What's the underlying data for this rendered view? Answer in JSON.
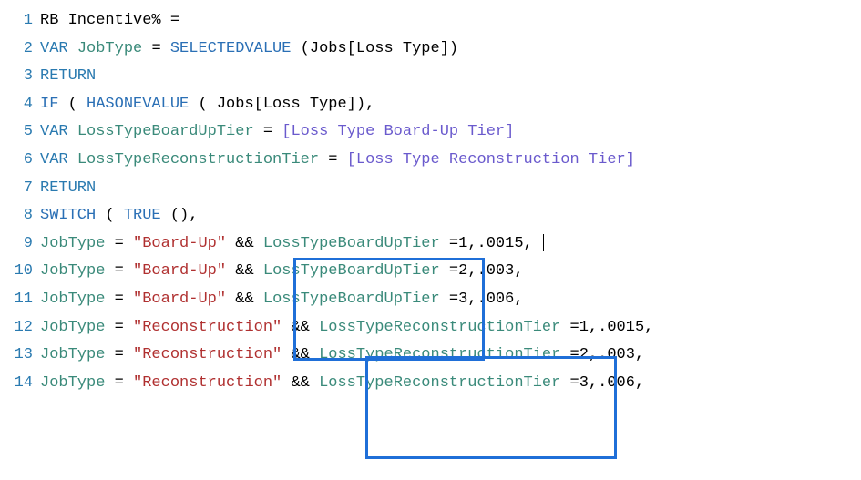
{
  "lines": {
    "l1": {
      "no": "1",
      "t1": "RB Incentive% ="
    },
    "l2": {
      "no": "2",
      "kw": "VAR",
      "ident": "JobType",
      "eq": "= ",
      "func": "SELECTEDVALUE",
      "args": "(Jobs[Loss Type])"
    },
    "l3": {
      "no": "3",
      "kw": "RETURN"
    },
    "l4": {
      "no": "4",
      "func1": "IF",
      "p1": "( ",
      "func2": "HASONEVALUE",
      "p2": "( Jobs[Loss Type]),"
    },
    "l5": {
      "no": "5",
      "kw": "VAR",
      "ident": "LossTypeBoardUpTier",
      "eq": " = ",
      "measure": "[Loss Type Board-Up Tier]"
    },
    "l6": {
      "no": "6",
      "kw": "VAR",
      "ident": "LossTypeReconstructionTier",
      "eq": " = ",
      "measure": "[Loss Type Reconstruction Tier]"
    },
    "l7": {
      "no": "7",
      "kw": "RETURN"
    },
    "l8": {
      "no": "8",
      "func": "SWITCH",
      "p1": "( ",
      "func2": "TRUE",
      "p2": "(),"
    },
    "l9": {
      "no": "9",
      "ident1": "JobType",
      "eq": "= ",
      "str": "\"Board-Up\"",
      "amp": " &&",
      "ident2": "LossTypeBoardUpTier",
      "rest": "=1,.0015,"
    },
    "l10": {
      "no": "10",
      "ident1": "JobType",
      "eq": "= ",
      "str": "\"Board-Up\"",
      "amp": " &&",
      "ident2": "LossTypeBoardUpTier",
      "rest": "=2,.003,"
    },
    "l11": {
      "no": "11",
      "ident1": "JobType",
      "eq": "= ",
      "str": "\"Board-Up\"",
      "amp": " &&",
      "ident2": "LossTypeBoardUpTier",
      "rest": "=3,.006,"
    },
    "l12": {
      "no": "12",
      "ident1": "JobType",
      "eq": "= ",
      "str": "\"Reconstruction\"",
      "amp": " &&",
      "ident2": "LossTypeReconstructionTier",
      "rest": "=1,.0015,"
    },
    "l13": {
      "no": "13",
      "ident1": "JobType",
      "eq": "= ",
      "str": "\"Reconstruction\"",
      "amp": " &&",
      "ident2": "LossTypeReconstructionTier",
      "rest": "=2,.003,"
    },
    "l14": {
      "no": "14",
      "ident1": "JobType",
      "eq": "= ",
      "str": "\"Reconstruction\"",
      "amp": " &&",
      "ident2": "LossTypeReconstructionTier",
      "rest": "=3,.006,"
    }
  }
}
